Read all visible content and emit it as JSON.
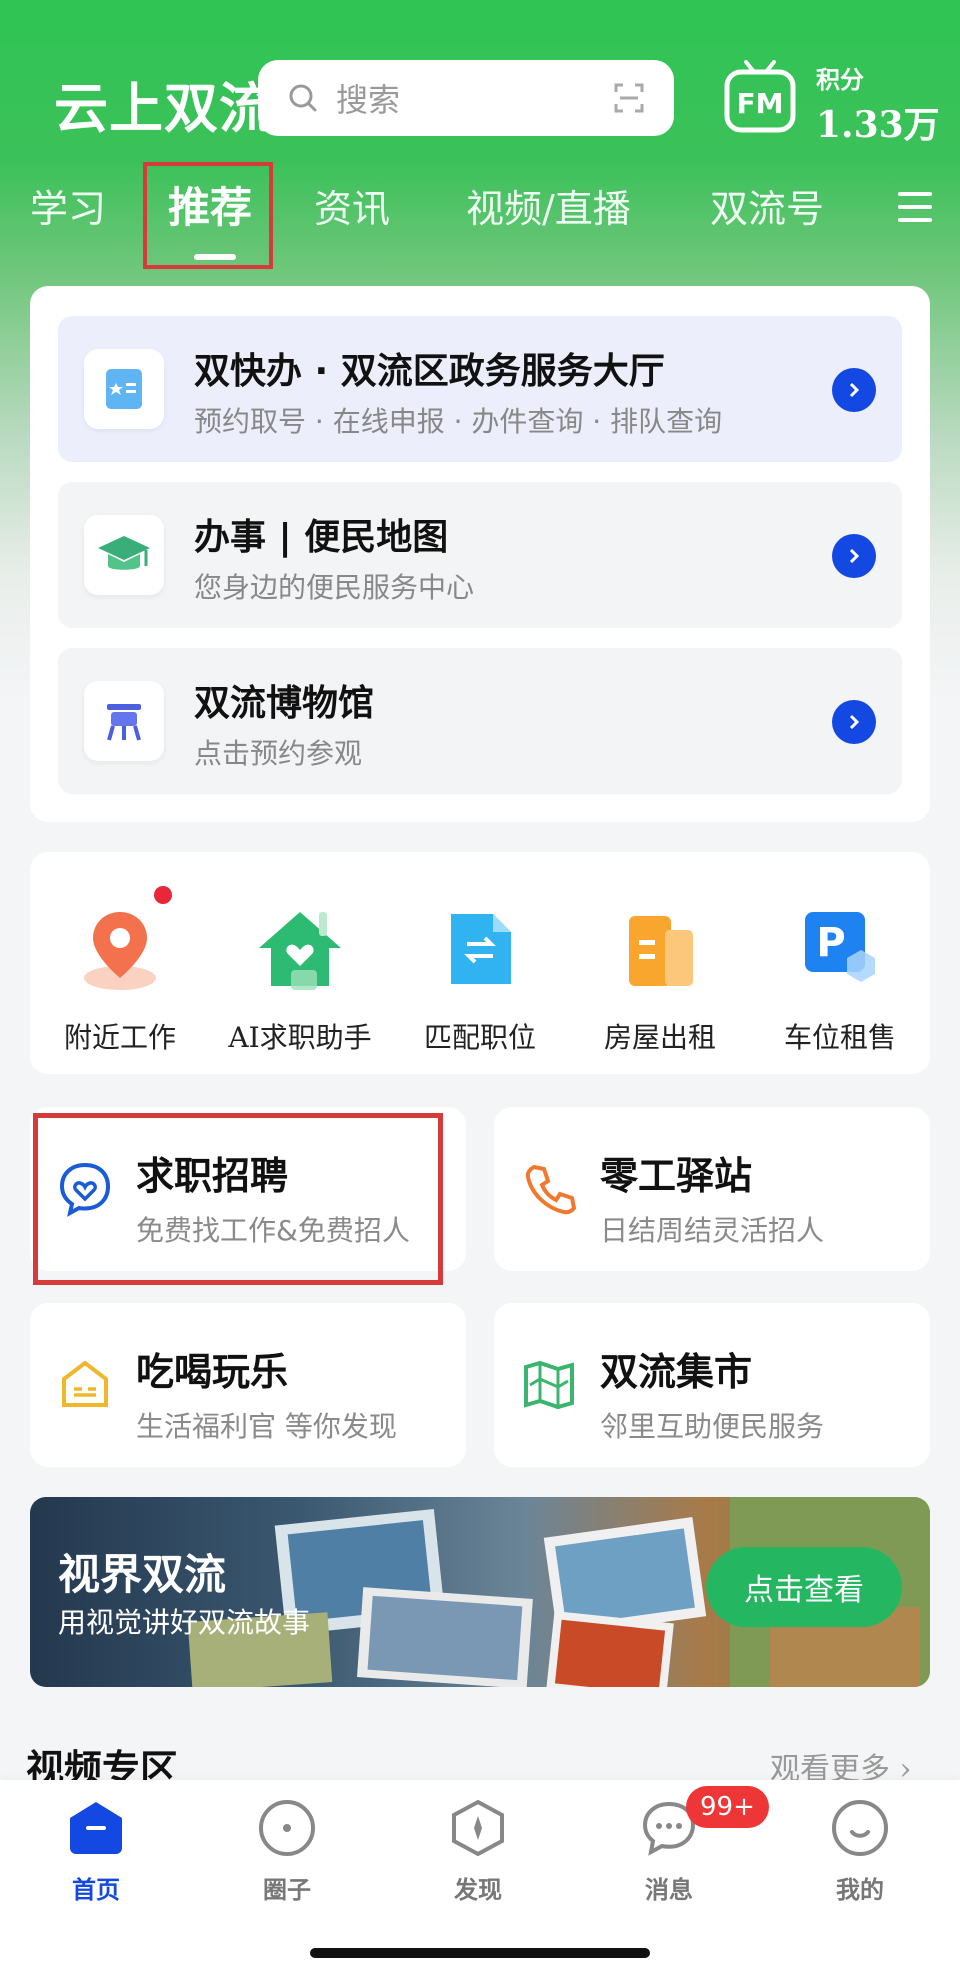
{
  "header": {
    "logo": "云上双流",
    "search_placeholder": "搜索",
    "points_label": "积分",
    "points_value": "1.33万"
  },
  "tabs": [
    {
      "label": "学习"
    },
    {
      "label": "推荐"
    },
    {
      "label": "资讯"
    },
    {
      "label": "视频/直播"
    },
    {
      "label": "双流号"
    }
  ],
  "services": [
    {
      "title": "双快办 · 双流区政务服务大厅",
      "subtitle": "预约取号 · 在线申报 · 办件查询 · 排队查询",
      "icon": "id-card-icon"
    },
    {
      "title": "办事 | 便民地图",
      "subtitle": "您身边的便民服务中心",
      "icon": "graduation-cap-icon"
    },
    {
      "title": "双流博物馆",
      "subtitle": "点击预约参观",
      "icon": "bronze-vessel-icon"
    }
  ],
  "quick_actions": [
    {
      "label": "附近工作",
      "icon": "location-pin-icon"
    },
    {
      "label": "AI求职助手",
      "icon": "house-heart-icon"
    },
    {
      "label": "匹配职位",
      "icon": "document-swap-icon"
    },
    {
      "label": "房屋出租",
      "icon": "building-icon"
    },
    {
      "label": "车位租售",
      "icon": "parking-icon"
    }
  ],
  "features": [
    {
      "title": "求职招聘",
      "subtitle": "免费找工作&免费招人",
      "icon": "heart-chat-icon"
    },
    {
      "title": "零工驿站",
      "subtitle": "日结周结灵活招人",
      "icon": "phone-icon"
    },
    {
      "title": "吃喝玩乐",
      "subtitle": "生活福利官 等你发现",
      "icon": "shop-icon"
    },
    {
      "title": "双流集市",
      "subtitle": "邻里互助便民服务",
      "icon": "map-icon"
    }
  ],
  "banner": {
    "title": "视界双流",
    "subtitle": "用视觉讲好双流故事",
    "button": "点击查看"
  },
  "video_section": {
    "title": "视频专区",
    "more": "观看更多"
  },
  "bottom_nav": [
    {
      "label": "首页"
    },
    {
      "label": "圈子"
    },
    {
      "label": "发现"
    },
    {
      "label": "消息"
    },
    {
      "label": "我的"
    }
  ],
  "messages_badge": "99+",
  "colors": {
    "brand_green": "#2fc454",
    "accent_blue": "#1448e3",
    "highlight_red": "#d63a3a"
  }
}
